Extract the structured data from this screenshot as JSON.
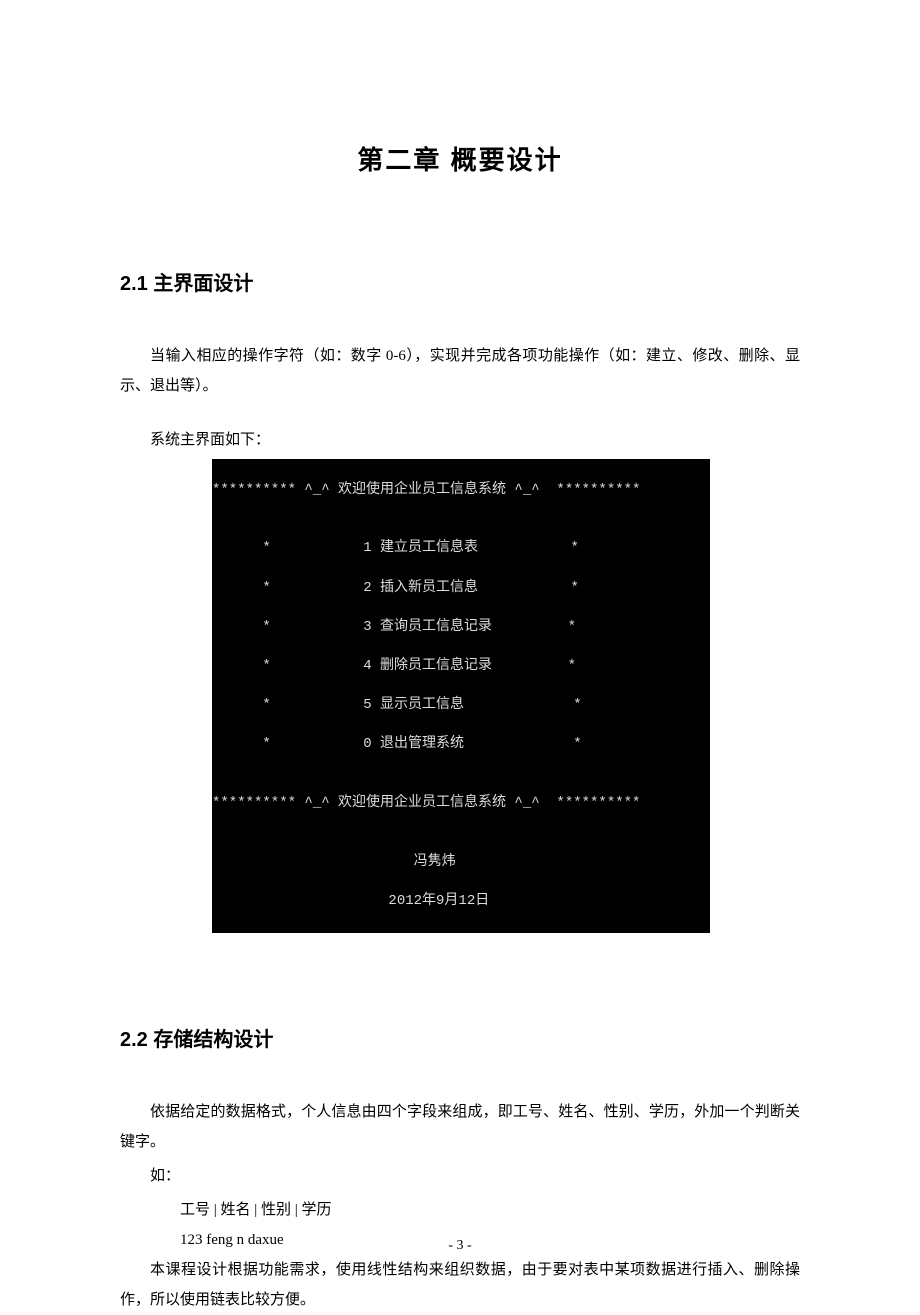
{
  "chapter_title": "第二章 概要设计",
  "section_2_1": {
    "title": "2.1  主界面设计",
    "para1": "当输入相应的操作字符（如：数字 0-6），实现并完成各项功能操作（如：建立、修改、删除、显示、退出等）。",
    "para2": "系统主界面如下："
  },
  "terminal": {
    "header": "********** ^_^ 欢迎使用企业员工信息系统 ^_^  **********",
    "blank": "",
    "menu": [
      "      *           1 建立员工信息表           *",
      "      *           2 插入新员工信息           *",
      "      *           3 查询员工信息记录         *",
      "      *           4 删除员工信息记录         *",
      "      *           5 显示员工信息             *",
      "      *           0 退出管理系统             *"
    ],
    "footer": "********** ^_^ 欢迎使用企业员工信息系统 ^_^  **********",
    "author": "                        冯隽炜",
    "date": "                     2012年9月12日"
  },
  "section_2_2": {
    "title": "2.2  存储结构设计",
    "para1": "依据给定的数据格式，个人信息由四个字段来组成，即工号、姓名、性别、学历，外加一个判断关键字。",
    "para2": "如：",
    "field_header": "工号  |  姓名  |  性别  |  学历",
    "field_example": "123   feng   n    daxue",
    "para3": "本课程设计根据功能需求，使用线性结构来组织数据，由于要对表中某项数据进行插入、删除操作，所以使用链表比较方便。"
  },
  "page_number": "- 3 -"
}
